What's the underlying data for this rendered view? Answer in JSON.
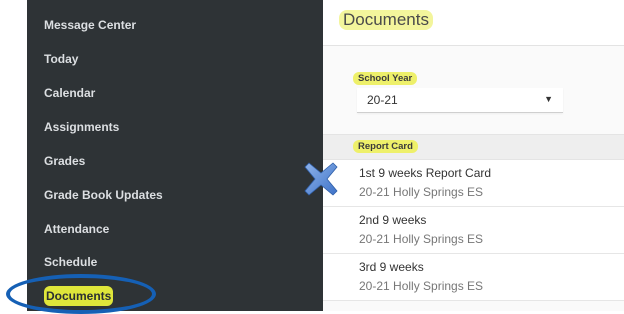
{
  "sidebar": {
    "items": [
      {
        "label": "Message Center"
      },
      {
        "label": "Today"
      },
      {
        "label": "Calendar"
      },
      {
        "label": "Assignments"
      },
      {
        "label": "Grades"
      },
      {
        "label": "Grade Book Updates"
      },
      {
        "label": "Attendance"
      },
      {
        "label": "Schedule"
      },
      {
        "label": "Documents",
        "active": true
      }
    ]
  },
  "main": {
    "title": "Documents",
    "school_year": {
      "label": "School Year",
      "selected": "20-21"
    },
    "report_card": {
      "label": "Report Card",
      "items": [
        {
          "title": "1st 9 weeks Report Card",
          "subtitle": "20-21 Holly Springs ES"
        },
        {
          "title": "2nd 9 weeks",
          "subtitle": "20-21 Holly Springs ES"
        },
        {
          "title": "3rd 9 weeks",
          "subtitle": "20-21 Holly Springs ES"
        }
      ]
    }
  },
  "annotations": {
    "x_icon": "x-mark-icon",
    "highlight_color": "#eef06a",
    "circle_color": "#1560b5"
  }
}
